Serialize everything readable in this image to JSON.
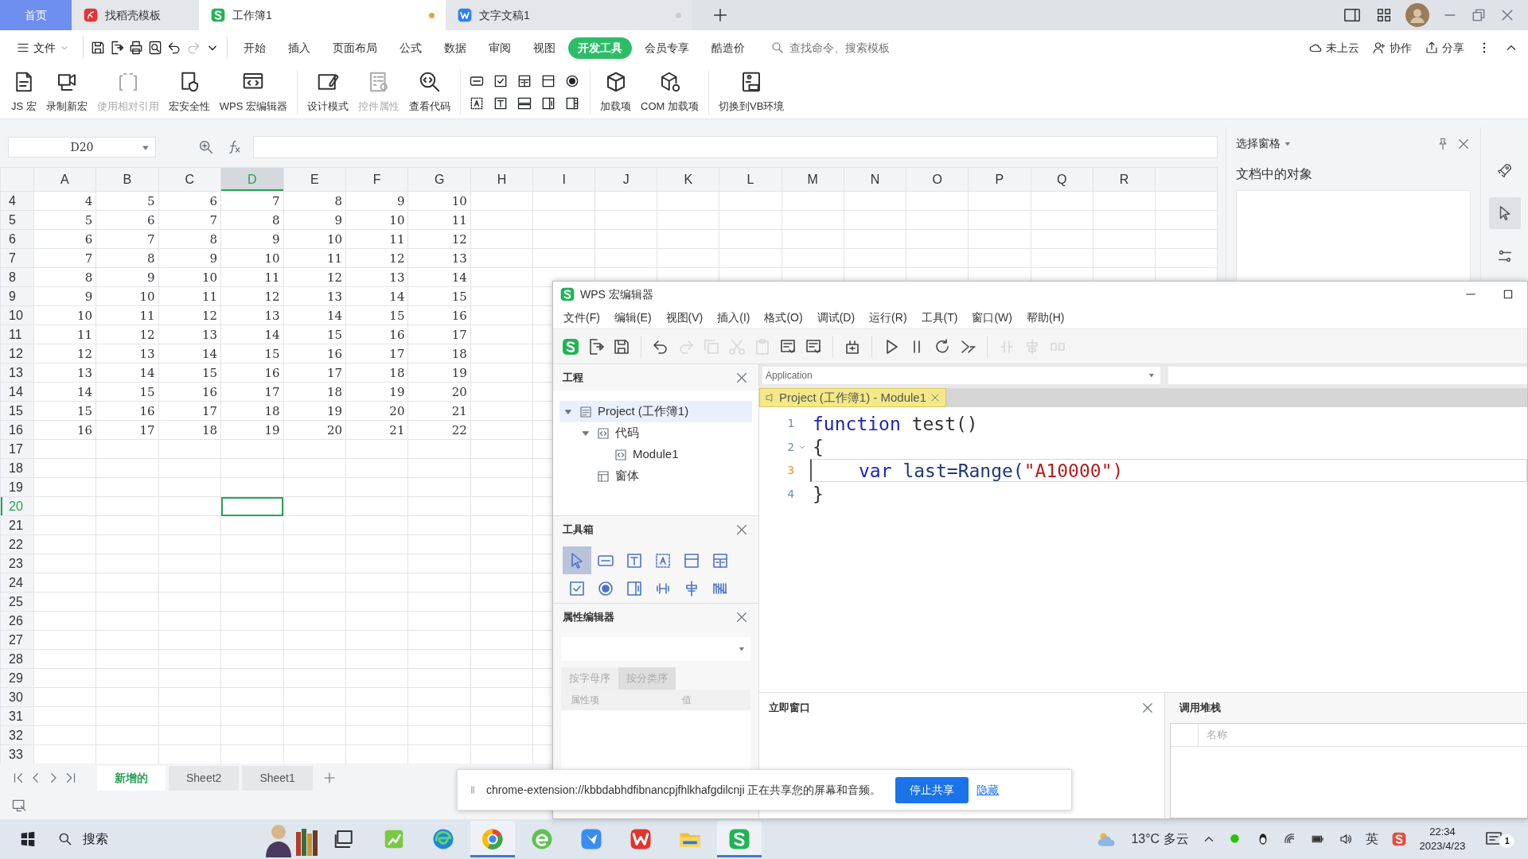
{
  "browser_tabs": [
    {
      "kind": "home",
      "label": "首页",
      "selected": false
    },
    {
      "kind": "doc",
      "label": "找稻壳模板",
      "selected": false
    },
    {
      "kind": "doc",
      "label": "工作簿1",
      "selected": true,
      "unsaved": true
    },
    {
      "kind": "doc",
      "label": "文字文稿1",
      "selected": false,
      "unsaved": false
    }
  ],
  "menu": {
    "file": "文件",
    "quick_access": [
      {
        "disabled": false
      },
      {
        "disabled": false
      },
      {
        "disabled": false
      },
      {
        "disabled": false
      },
      {
        "disabled": false
      },
      {
        "disabled": true
      },
      {
        "disabled": false
      }
    ],
    "tabs": [
      {
        "label": "开始",
        "selected": false
      },
      {
        "label": "插入",
        "selected": false
      },
      {
        "label": "页面布局",
        "selected": false
      },
      {
        "label": "公式",
        "selected": false
      },
      {
        "label": "数据",
        "selected": false
      },
      {
        "label": "审阅",
        "selected": false
      },
      {
        "label": "视图",
        "selected": false
      },
      {
        "label": "开发工具",
        "selected": true
      },
      {
        "label": "会员专享",
        "selected": false
      },
      {
        "label": "酷造价",
        "selected": false
      }
    ],
    "search": {
      "placeholder": "查找命令、搜索模板"
    },
    "actions": [
      "未上云",
      "协作",
      "分享"
    ]
  },
  "ribbon": [
    {
      "label": "JS 宏",
      "disabled": false
    },
    {
      "label": "录制新宏",
      "disabled": false
    },
    {
      "label": "使用相对引用",
      "disabled": true
    },
    {
      "label": "宏安全性",
      "disabled": false
    },
    {
      "label": "WPS 宏编辑器",
      "disabled": false
    },
    {
      "label": "设计模式",
      "disabled": false
    },
    {
      "label": "控件属性",
      "disabled": true
    },
    {
      "label": "查看代码",
      "disabled": false
    },
    {
      "label": "加载项",
      "disabled": false
    },
    {
      "label": "COM 加载项",
      "disabled": false
    },
    {
      "label": "切换到VB环境",
      "disabled": false
    }
  ],
  "formula_bar": {
    "name_box": "D20"
  },
  "sheet": {
    "columns": [
      {
        "label": "A",
        "selected": false
      },
      {
        "label": "B",
        "selected": false
      },
      {
        "label": "C",
        "selected": false
      },
      {
        "label": "D",
        "selected": true
      },
      {
        "label": "E",
        "selected": false
      },
      {
        "label": "F",
        "selected": false
      },
      {
        "label": "G",
        "selected": false
      },
      {
        "label": "H",
        "selected": false
      },
      {
        "label": "I",
        "selected": false
      },
      {
        "label": "J",
        "selected": false
      },
      {
        "label": "K",
        "selected": false
      },
      {
        "label": "L",
        "selected": false
      },
      {
        "label": "M",
        "selected": false
      },
      {
        "label": "N",
        "selected": false
      },
      {
        "label": "O",
        "selected": false
      },
      {
        "label": "P",
        "selected": false
      },
      {
        "label": "Q",
        "selected": false
      },
      {
        "label": "R",
        "selected": false
      }
    ],
    "rows": [
      {
        "label": "4",
        "selected": false,
        "cells": [
          "4",
          "5",
          "6",
          "7",
          "8",
          "9",
          "10"
        ]
      },
      {
        "label": "5",
        "selected": false,
        "cells": [
          "5",
          "6",
          "7",
          "8",
          "9",
          "10",
          "11"
        ]
      },
      {
        "label": "6",
        "selected": false,
        "cells": [
          "6",
          "7",
          "8",
          "9",
          "10",
          "11",
          "12"
        ]
      },
      {
        "label": "7",
        "selected": false,
        "cells": [
          "7",
          "8",
          "9",
          "10",
          "11",
          "12",
          "13"
        ]
      },
      {
        "label": "8",
        "selected": false,
        "cells": [
          "8",
          "9",
          "10",
          "11",
          "12",
          "13",
          "14"
        ]
      },
      {
        "label": "9",
        "selected": false,
        "cells": [
          "9",
          "10",
          "11",
          "12",
          "13",
          "14",
          "15"
        ]
      },
      {
        "label": "10",
        "selected": false,
        "cells": [
          "10",
          "11",
          "12",
          "13",
          "14",
          "15",
          "16"
        ]
      },
      {
        "label": "11",
        "selected": false,
        "cells": [
          "11",
          "12",
          "13",
          "14",
          "15",
          "16",
          "17"
        ]
      },
      {
        "label": "12",
        "selected": false,
        "cells": [
          "12",
          "13",
          "14",
          "15",
          "16",
          "17",
          "18"
        ]
      },
      {
        "label": "13",
        "selected": false,
        "cells": [
          "13",
          "14",
          "15",
          "16",
          "17",
          "18",
          "19"
        ]
      },
      {
        "label": "14",
        "selected": false,
        "cells": [
          "14",
          "15",
          "16",
          "17",
          "18",
          "19",
          "20"
        ]
      },
      {
        "label": "15",
        "selected": false,
        "cells": [
          "15",
          "16",
          "17",
          "18",
          "19",
          "20",
          "21"
        ]
      },
      {
        "label": "16",
        "selected": false,
        "cells": [
          "16",
          "17",
          "18",
          "19",
          "20",
          "21",
          "22"
        ]
      },
      {
        "label": "17",
        "selected": false
      },
      {
        "label": "18",
        "selected": false
      },
      {
        "label": "19",
        "selected": false
      },
      {
        "label": "20",
        "selected": true
      },
      {
        "label": "21",
        "selected": false
      },
      {
        "label": "22",
        "selected": false
      },
      {
        "label": "23",
        "selected": false
      },
      {
        "label": "24",
        "selected": false
      },
      {
        "label": "25",
        "selected": false
      },
      {
        "label": "26",
        "selected": false
      },
      {
        "label": "27",
        "selected": false
      },
      {
        "label": "28",
        "selected": false
      },
      {
        "label": "29",
        "selected": false
      },
      {
        "label": "30",
        "selected": false
      },
      {
        "label": "31",
        "selected": false
      },
      {
        "label": "32",
        "selected": false
      },
      {
        "label": "33",
        "selected": false
      }
    ]
  },
  "sheet_tabs": [
    {
      "label": "新增的",
      "selected": true
    },
    {
      "label": "Sheet2",
      "selected": false
    },
    {
      "label": "Sheet1",
      "selected": false
    }
  ],
  "selection_pane": {
    "title": "选择窗格",
    "heading": "文档中的对象"
  },
  "side_tools": [
    {
      "selected": false
    },
    {
      "selected": true
    },
    {
      "selected": false
    }
  ],
  "macro_editor": {
    "title": "WPS 宏编辑器",
    "menu": [
      "文件(F)",
      "编辑(E)",
      "视图(V)",
      "插入(I)",
      "格式(O)",
      "调试(D)",
      "运行(R)",
      "工具(T)",
      "窗口(W)",
      "帮助(H)"
    ],
    "toolbar": [
      {
        "disabled": false
      },
      {
        "disabled": false
      },
      {
        "disabled": false
      },
      {
        "disabled": false
      },
      {
        "disabled": true
      },
      {
        "disabled": true
      },
      {
        "disabled": true
      },
      {
        "disabled": true
      },
      {
        "disabled": false
      },
      {
        "disabled": false
      },
      {
        "disabled": false
      },
      {
        "disabled": false
      },
      {
        "disabled": false
      },
      {
        "disabled": false
      },
      {
        "disabled": false
      },
      {
        "disabled": true
      },
      {
        "disabled": true
      },
      {
        "disabled": true
      }
    ],
    "project": {
      "title": "工程",
      "tree": [
        {
          "label": "Project (工作簿1)",
          "selected": true,
          "expanded": true,
          "children": [
            {
              "label": "代码",
              "selected": false,
              "expanded": true,
              "children": [
                {
                  "label": "Module1",
                  "selected": false
                }
              ]
            },
            {
              "label": "窗体",
              "selected": false
            }
          ]
        }
      ]
    },
    "toolbox": {
      "title": "工具箱",
      "tools": [
        {
          "selected": true
        },
        {
          "selected": false
        },
        {
          "selected": false
        },
        {
          "selected": false
        },
        {
          "selected": false
        },
        {
          "selected": false
        },
        {
          "selected": false
        },
        {
          "selected": false
        },
        {
          "selected": false
        },
        {
          "selected": false
        },
        {
          "selected": false
        },
        {
          "selected": false
        }
      ]
    },
    "properties": {
      "title": "属性编辑器",
      "tabs": [
        {
          "label": "按字母序",
          "selected": false
        },
        {
          "label": "按分类序",
          "selected": true
        }
      ],
      "columns": [
        "属性项",
        "值"
      ]
    },
    "object_box": "Application",
    "code_tab": "Project (工作簿1) - Module1",
    "code": [
      {
        "number": "1",
        "current": false,
        "foldable": false,
        "indented": false,
        "tokens": [
          {
            "kind": "keyword",
            "text": "function"
          },
          {
            "kind": "plain",
            "text": " test()"
          }
        ]
      },
      {
        "number": "2",
        "current": false,
        "foldable": true,
        "indented": false,
        "tokens": [
          {
            "kind": "plain",
            "text": "{"
          }
        ]
      },
      {
        "number": "3",
        "current": true,
        "foldable": false,
        "indented": true,
        "tokens": [
          {
            "kind": "keyword",
            "text": "var"
          },
          {
            "kind": "name",
            "text": " last=Range("
          },
          {
            "kind": "string",
            "text": "\"A10000\")"
          }
        ]
      },
      {
        "number": "4",
        "current": false,
        "foldable": false,
        "indented": false,
        "tokens": [
          {
            "kind": "plain",
            "text": "}"
          }
        ]
      }
    ],
    "immediate": {
      "title": "立即窗口"
    },
    "call_stack": {
      "title": "调用堆栈",
      "columns": [
        "名称"
      ]
    }
  },
  "share_notice": {
    "text": "chrome-extension://kbbdabhdfibnancpjfhlkhafgdilcnji 正在共享您的屏幕和音频。",
    "stop": "停止共享",
    "hide": "隐藏"
  },
  "taskbar": {
    "search": "搜索",
    "apps": [
      {
        "active": false
      },
      {
        "active": false
      },
      {
        "active": false
      },
      {
        "active": true
      },
      {
        "active": false
      },
      {
        "active": false
      },
      {
        "active": false
      },
      {
        "active": false
      },
      {
        "active": true
      }
    ],
    "weather": {
      "temperature": "13°C",
      "condition": "多云"
    },
    "ime": "英",
    "time": "22:34",
    "date": "2023/4/23",
    "notifications": "1"
  }
}
